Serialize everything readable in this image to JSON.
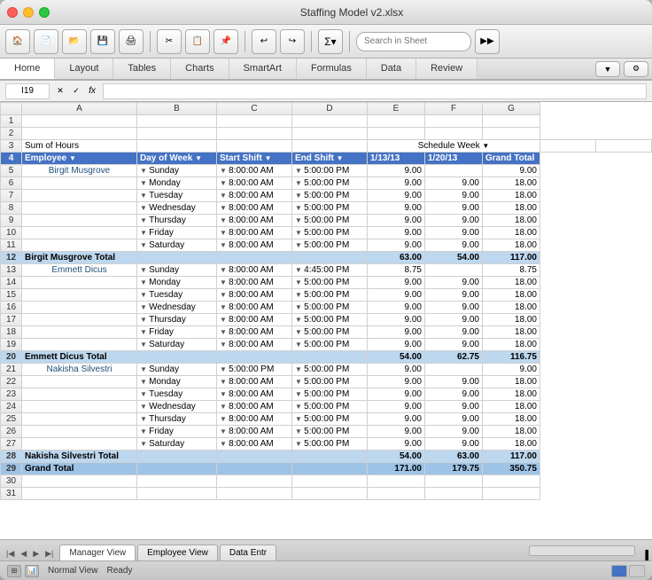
{
  "window": {
    "title": "Staffing Model v2.xlsx"
  },
  "ribbon_tabs": [
    {
      "label": "Home",
      "active": true
    },
    {
      "label": "Layout",
      "active": false
    },
    {
      "label": "Tables",
      "active": false
    },
    {
      "label": "Charts",
      "active": false
    },
    {
      "label": "SmartArt",
      "active": false
    },
    {
      "label": "Formulas",
      "active": false
    },
    {
      "label": "Data",
      "active": false
    },
    {
      "label": "Review",
      "active": false
    }
  ],
  "formula_bar": {
    "cell_ref": "I19",
    "formula": "fx"
  },
  "headers": {
    "row_num": "#",
    "col_a": "A",
    "col_b": "B",
    "col_c": "C",
    "col_d": "D",
    "col_e": "E",
    "col_f": "F",
    "col_g": "G"
  },
  "rows": [
    {
      "row": "1",
      "a": "",
      "b": "",
      "c": "",
      "d": "",
      "e": "",
      "f": "",
      "g": ""
    },
    {
      "row": "2",
      "a": "",
      "b": "",
      "c": "",
      "d": "",
      "e": "",
      "f": "",
      "g": ""
    },
    {
      "row": "3",
      "a": "Sum of Hours",
      "b": "",
      "c": "",
      "d": "",
      "e": "Schedule Week",
      "f": "",
      "g": "",
      "type": "label"
    },
    {
      "row": "4",
      "a": "Employee",
      "b": "Day of Week",
      "c": "Start Shift",
      "d": "End Shift",
      "e": "1/13/13",
      "f": "1/20/13",
      "g": "Grand Total",
      "type": "header"
    },
    {
      "row": "5",
      "a": "Birgit Musgrove",
      "b": "Sunday",
      "c": "8:00:00 AM",
      "d": "5:00:00 PM",
      "e": "9.00",
      "f": "",
      "g": "9.00"
    },
    {
      "row": "6",
      "a": "",
      "b": "Monday",
      "c": "8:00:00 AM",
      "d": "5:00:00 PM",
      "e": "9.00",
      "f": "9.00",
      "g": "18.00"
    },
    {
      "row": "7",
      "a": "",
      "b": "Tuesday",
      "c": "8:00:00 AM",
      "d": "5:00:00 PM",
      "e": "9.00",
      "f": "9.00",
      "g": "18.00"
    },
    {
      "row": "8",
      "a": "",
      "b": "Wednesday",
      "c": "8:00:00 AM",
      "d": "5:00:00 PM",
      "e": "9.00",
      "f": "9.00",
      "g": "18.00"
    },
    {
      "row": "9",
      "a": "",
      "b": "Thursday",
      "c": "8:00:00 AM",
      "d": "5:00:00 PM",
      "e": "9.00",
      "f": "9.00",
      "g": "18.00"
    },
    {
      "row": "10",
      "a": "",
      "b": "Friday",
      "c": "8:00:00 AM",
      "d": "5:00:00 PM",
      "e": "9.00",
      "f": "9.00",
      "g": "18.00"
    },
    {
      "row": "11",
      "a": "",
      "b": "Saturday",
      "c": "8:00:00 AM",
      "d": "5:00:00 PM",
      "e": "9.00",
      "f": "9.00",
      "g": "18.00"
    },
    {
      "row": "12",
      "a": "Birgit Musgrove Total",
      "b": "",
      "c": "",
      "d": "",
      "e": "63.00",
      "f": "54.00",
      "g": "117.00",
      "type": "total"
    },
    {
      "row": "13",
      "a": "Emmett Dicus",
      "b": "Sunday",
      "c": "8:00:00 AM",
      "d": "4:45:00 PM",
      "e": "8.75",
      "f": "",
      "g": "8.75"
    },
    {
      "row": "14",
      "a": "",
      "b": "Monday",
      "c": "8:00:00 AM",
      "d": "5:00:00 PM",
      "e": "9.00",
      "f": "9.00",
      "g": "18.00"
    },
    {
      "row": "15",
      "a": "",
      "b": "Tuesday",
      "c": "8:00:00 AM",
      "d": "5:00:00 PM",
      "e": "9.00",
      "f": "9.00",
      "g": "18.00"
    },
    {
      "row": "16",
      "a": "",
      "b": "Wednesday",
      "c": "8:00:00 AM",
      "d": "5:00:00 PM",
      "e": "9.00",
      "f": "9.00",
      "g": "18.00"
    },
    {
      "row": "17",
      "a": "",
      "b": "Thursday",
      "c": "8:00:00 AM",
      "d": "5:00:00 PM",
      "e": "9.00",
      "f": "9.00",
      "g": "18.00"
    },
    {
      "row": "18",
      "a": "",
      "b": "Friday",
      "c": "8:00:00 AM",
      "d": "5:00:00 PM",
      "e": "9.00",
      "f": "9.00",
      "g": "18.00"
    },
    {
      "row": "19",
      "a": "",
      "b": "Saturday",
      "c": "8:00:00 AM",
      "d": "5:00:00 PM",
      "e": "9.00",
      "f": "9.00",
      "g": "18.00"
    },
    {
      "row": "20",
      "a": "Emmett Dicus Total",
      "b": "",
      "c": "",
      "d": "",
      "e": "54.00",
      "f": "62.75",
      "g": "116.75",
      "type": "total"
    },
    {
      "row": "21",
      "a": "Nakisha Silvestri",
      "b": "Sunday",
      "c": "5:00:00 PM",
      "d": "5:00:00 PM",
      "e": "9.00",
      "f": "",
      "g": "9.00"
    },
    {
      "row": "22",
      "a": "",
      "b": "Monday",
      "c": "8:00:00 AM",
      "d": "5:00:00 PM",
      "e": "9.00",
      "f": "9.00",
      "g": "18.00"
    },
    {
      "row": "23",
      "a": "",
      "b": "Tuesday",
      "c": "8:00:00 AM",
      "d": "5:00:00 PM",
      "e": "9.00",
      "f": "9.00",
      "g": "18.00"
    },
    {
      "row": "24",
      "a": "",
      "b": "Wednesday",
      "c": "8:00:00 AM",
      "d": "5:00:00 PM",
      "e": "9.00",
      "f": "9.00",
      "g": "18.00"
    },
    {
      "row": "25",
      "a": "",
      "b": "Thursday",
      "c": "8:00:00 AM",
      "d": "5:00:00 PM",
      "e": "9.00",
      "f": "9.00",
      "g": "18.00"
    },
    {
      "row": "26",
      "a": "",
      "b": "Friday",
      "c": "8:00:00 AM",
      "d": "5:00:00 PM",
      "e": "9.00",
      "f": "9.00",
      "g": "18.00"
    },
    {
      "row": "27",
      "a": "",
      "b": "Saturday",
      "c": "8:00:00 AM",
      "d": "5:00:00 PM",
      "e": "9.00",
      "f": "9.00",
      "g": "18.00"
    },
    {
      "row": "28",
      "a": "Nakisha Silvestri Total",
      "b": "",
      "c": "",
      "d": "",
      "e": "54.00",
      "f": "63.00",
      "g": "117.00",
      "type": "total"
    },
    {
      "row": "29",
      "a": "Grand Total",
      "b": "",
      "c": "",
      "d": "",
      "e": "171.00",
      "f": "179.75",
      "g": "350.75",
      "type": "grand"
    },
    {
      "row": "30",
      "a": "",
      "b": "",
      "c": "",
      "d": "",
      "e": "",
      "f": "",
      "g": ""
    },
    {
      "row": "31",
      "a": "",
      "b": "",
      "c": "",
      "d": "",
      "e": "",
      "f": "",
      "g": ""
    }
  ],
  "sheet_tabs": [
    {
      "label": "Manager View",
      "active": true
    },
    {
      "label": "Employee View",
      "active": false
    },
    {
      "label": "Data Entr",
      "active": false
    }
  ],
  "status": {
    "view_mode": "Normal View",
    "ready": "Ready"
  },
  "search_placeholder": "Search in Sheet"
}
